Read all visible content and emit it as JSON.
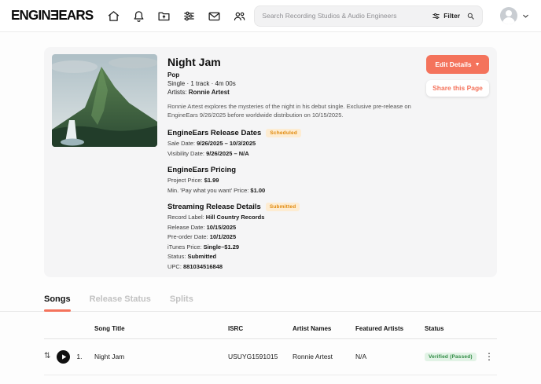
{
  "header": {
    "logo": "ENGINƎEARS",
    "search_placeholder": "Search Recording Studios & Audio Engineers",
    "filter_label": "Filter"
  },
  "release": {
    "title": "Night Jam",
    "genre": "Pop",
    "meta": "Single · 1 track · 4m 00s",
    "artists_label": "Artists:",
    "artists_value": "Ronnie Artest",
    "description": "Ronnie Artest explores the mysteries of the night in his debut single. Exclusive pre-release on EngineEars 9/26/2025 before worldwide distribution on 10/15/2025.",
    "edit_button": "Edit Details",
    "edit_caret": "▼",
    "share_button": "Share this Page",
    "release_dates": {
      "title": "EngineEars Release Dates",
      "badge": "Scheduled",
      "rows": [
        {
          "label": "Sale Date:",
          "value": "9/26/2025 – 10/3/2025"
        },
        {
          "label": "Visibility Date:",
          "value": "9/26/2025 – N/A"
        }
      ]
    },
    "pricing": {
      "title": "EngineEars Pricing",
      "rows": [
        {
          "label": "Project Price:",
          "value": "$1.99"
        },
        {
          "label": "Min. 'Pay what you want' Price:",
          "value": "$1.00"
        }
      ]
    },
    "streaming": {
      "title": "Streaming Release Details",
      "badge": "Submitted",
      "rows": [
        {
          "label": "Record Label:",
          "value": "Hill Country Records"
        },
        {
          "label": "Release Date:",
          "value": "10/15/2025"
        },
        {
          "label": "Pre-order Date:",
          "value": "10/1/2025"
        },
        {
          "label": "iTunes Price:",
          "value": "Single–$1.29"
        },
        {
          "label": "Status:",
          "value": "Submitted"
        },
        {
          "label": "UPC:",
          "value": "881034516848"
        }
      ]
    }
  },
  "tabs": [
    {
      "label": "Songs"
    },
    {
      "label": "Release Status"
    },
    {
      "label": "Splits"
    }
  ],
  "table": {
    "headers": [
      "Song Title",
      "ISRC",
      "Artist Names",
      "Featured Artists",
      "Status"
    ],
    "rows": [
      {
        "number": "1.",
        "title": "Night Jam",
        "isrc": "USUYG1591015",
        "artist_names": "Ronnie Artest",
        "featured_artists": "N/A",
        "status": "Verified (Passed)"
      }
    ]
  },
  "colors": {
    "accent": "#F4735C",
    "badge_orange_bg": "#FDECD2",
    "badge_orange_text": "#E0880A",
    "badge_green_bg": "#E2F3E6",
    "badge_green_text": "#2F8A43"
  }
}
